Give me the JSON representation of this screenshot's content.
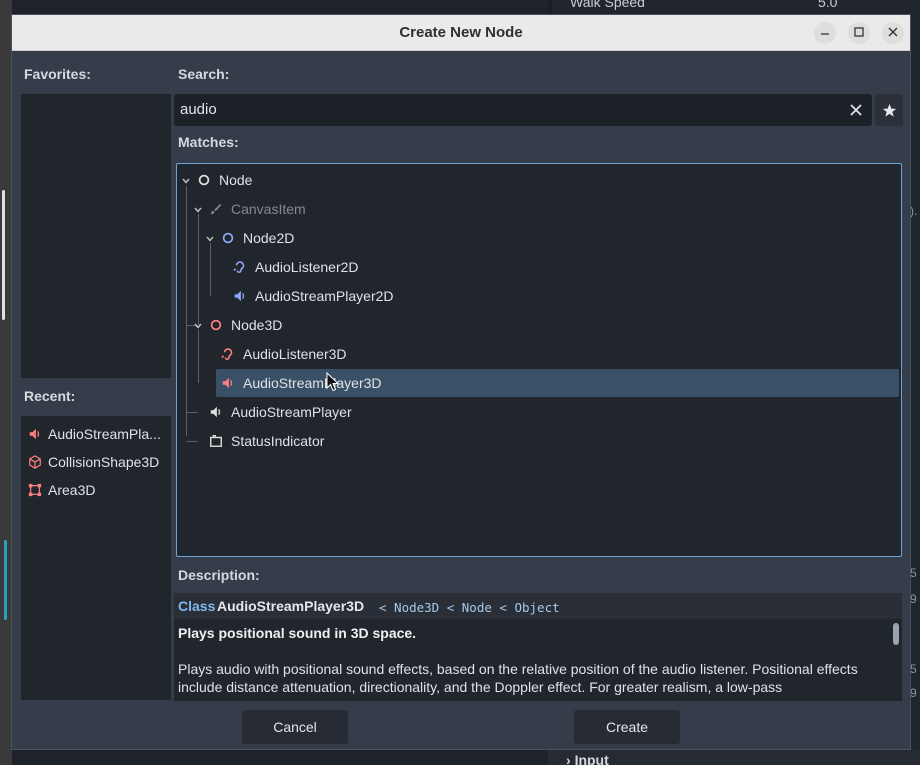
{
  "background": {
    "walk_speed_label": "Walk Speed",
    "walk_speed_value": "5.0",
    "input_section": "Input",
    "edge_digits": [
      ").",
      "5",
      "9",
      "5",
      "9"
    ]
  },
  "dialog": {
    "title": "Create New Node",
    "favorites_label": "Favorites:",
    "recent_label": "Recent:",
    "recent": [
      {
        "label": "AudioStreamPla...",
        "icon": "speaker-icon",
        "color": "#fc7f7f"
      },
      {
        "label": "CollisionShape3D",
        "icon": "cube-icon",
        "color": "#fc7f7f"
      },
      {
        "label": "Area3D",
        "icon": "area-icon",
        "color": "#fc7f7f"
      }
    ],
    "search_label": "Search:",
    "search_value": "audio",
    "matches_label": "Matches:",
    "tree": [
      {
        "label": "Node",
        "icon": "circle-icon",
        "color": "#e0e0e0",
        "depth": 0
      },
      {
        "label": "CanvasItem",
        "icon": "brush-icon",
        "color": "#838a93",
        "depth": 1,
        "disabled": true
      },
      {
        "label": "Node2D",
        "icon": "circle-icon",
        "color": "#8da5f3",
        "depth": 2
      },
      {
        "label": "AudioListener2D",
        "icon": "ear-icon",
        "color": "#8da5f3",
        "depth": 3
      },
      {
        "label": "AudioStreamPlayer2D",
        "icon": "speaker-icon",
        "color": "#8da5f3",
        "depth": 3
      },
      {
        "label": "Node3D",
        "icon": "circle-icon",
        "color": "#fc7f7f",
        "depth": 1
      },
      {
        "label": "AudioListener3D",
        "icon": "ear-icon",
        "color": "#fc7f7f",
        "depth": 2
      },
      {
        "label": "AudioStreamPlayer3D",
        "icon": "speaker-icon",
        "color": "#fc7f7f",
        "depth": 2,
        "selected": true
      },
      {
        "label": "AudioStreamPlayer",
        "icon": "speaker-icon",
        "color": "#e0e0e0",
        "depth": 1
      },
      {
        "label": "StatusIndicator",
        "icon": "frame-icon",
        "color": "#e0e0e0",
        "depth": 1
      }
    ],
    "description_label": "Description:",
    "description": {
      "class_keyword": "Class",
      "class_name": "AudioStreamPlayer3D",
      "inherits": "< Node3D < Node < Object",
      "brief": "Plays positional sound in 3D space.",
      "body": "Plays audio with positional sound effects, based on the relative position of the audio listener. Positional effects include distance attenuation, directionality, and the Doppler effect. For greater realism, a low-pass"
    },
    "cancel_label": "Cancel",
    "create_label": "Create"
  }
}
